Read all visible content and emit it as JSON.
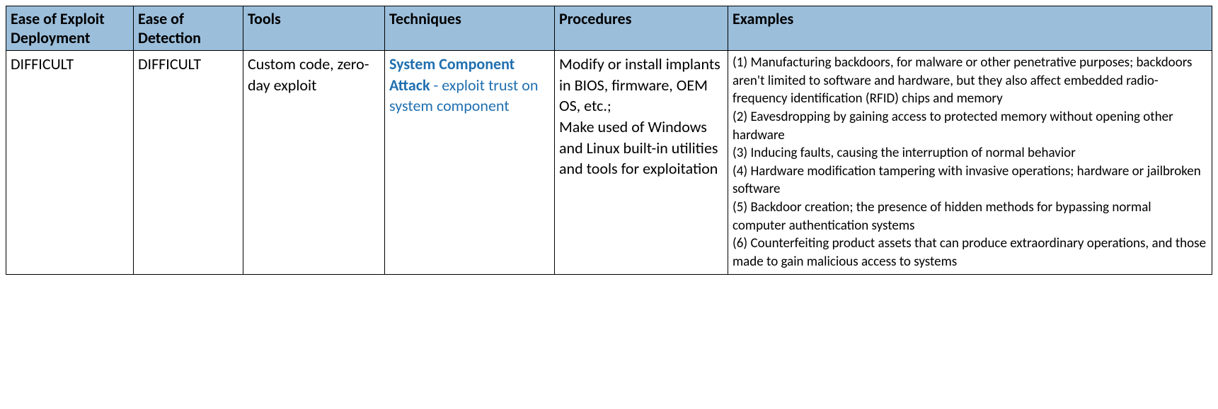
{
  "headers": {
    "deploy": "Ease of Exploit Deployment",
    "detect": "Ease of Detection",
    "tools": "Tools",
    "techniques": "Techniques",
    "procedures": "Procedures",
    "examples": "Examples"
  },
  "row": {
    "deploy": "DIFFICULT",
    "detect": "DIFFICULT",
    "tools": "Custom code, zero-day exploit",
    "tech_link": "System Component Attack",
    "tech_rest": " - exploit trust on system component",
    "proc1": "Modify or install implants in BIOS, firmware, OEM OS, etc.;",
    "proc2": "Make used of Windows and Linux built-in utilities and tools for exploitation",
    "examples": {
      "e1": "(1) Manufacturing backdoors, for malware or other penetrative purposes; backdoors aren't limited to software and hardware, but they also affect embedded radio-frequency identification (RFID) chips and memory",
      "e2": "(2) Eavesdropping by gaining access to protected memory without opening other hardware",
      "e3": "(3) Inducing faults, causing the interruption of normal behavior",
      "e4": "(4) Hardware modification tampering with invasive operations; hardware or jailbroken software",
      "e5": "(5) Backdoor creation; the presence of hidden methods for bypassing normal computer authentication systems",
      "e6": "(6) Counterfeiting product assets that can produce extraordinary operations, and those made to gain malicious access to systems"
    }
  }
}
